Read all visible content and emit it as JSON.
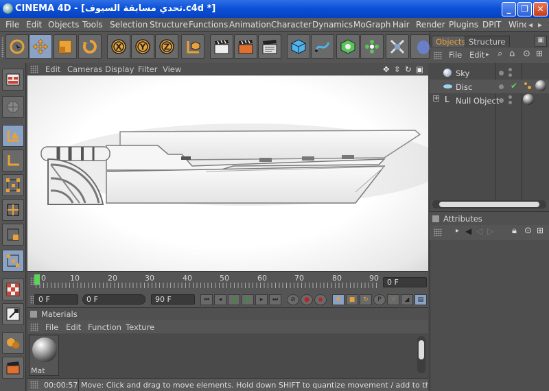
{
  "window": {
    "title": "CINEMA 4D - [تحدي مسابقة السيوف.c4d *]",
    "buttons": {
      "minimize": "_",
      "maximize": "❐",
      "close": "✕"
    }
  },
  "menu": [
    "File",
    "Edit",
    "Objects",
    "Tools",
    "Selection",
    "Structure",
    "Functions",
    "Animation",
    "Character",
    "Dynamics",
    "MoGraph",
    "Hair",
    "Render",
    "Plugins",
    "DPIT",
    "Wind"
  ],
  "toolbar": {
    "icons": [
      "live-selection",
      "move",
      "scale",
      "rotate",
      "x-axis",
      "y-axis",
      "z-axis",
      "coordinate-system",
      "render-view",
      "render-picture-viewer",
      "render-settings",
      "cube",
      "spline-pen",
      "nurbs",
      "array",
      "deformer",
      "camera-target"
    ],
    "axis_labels": {
      "x": "X",
      "y": "Y",
      "z": "Z"
    }
  },
  "viewport": {
    "menu": [
      "Edit",
      "Cameras",
      "Display",
      "Filter",
      "View"
    ]
  },
  "timeline": {
    "ticks": [
      "0",
      "10",
      "20",
      "30",
      "40",
      "50",
      "60",
      "70",
      "80",
      "90"
    ],
    "current_frame": "0 F"
  },
  "transport": {
    "start_field": "0 F",
    "slider_field": "0 F",
    "end_field": "90 F"
  },
  "materials": {
    "title": "Materials",
    "menu": [
      "File",
      "Edit",
      "Function",
      "Texture"
    ],
    "items": [
      {
        "name": "Mat"
      }
    ]
  },
  "status": {
    "time": "00:00:57",
    "message": "Move: Click and drag to move elements. Hold down SHIFT to quantize movement / add to the selection in point mode"
  },
  "objects_panel": {
    "tabs": [
      "Objects",
      "Structure"
    ],
    "menu": [
      "File",
      "Edit"
    ],
    "items": [
      {
        "name": "Sky"
      },
      {
        "name": "Disc"
      },
      {
        "name": "Null Object"
      }
    ]
  },
  "attributes": {
    "title": "Attributes"
  },
  "colors": {
    "accent": "#e8a238",
    "title_bar": "#0a4fd6",
    "selected_tool": "#8aa2c4"
  }
}
